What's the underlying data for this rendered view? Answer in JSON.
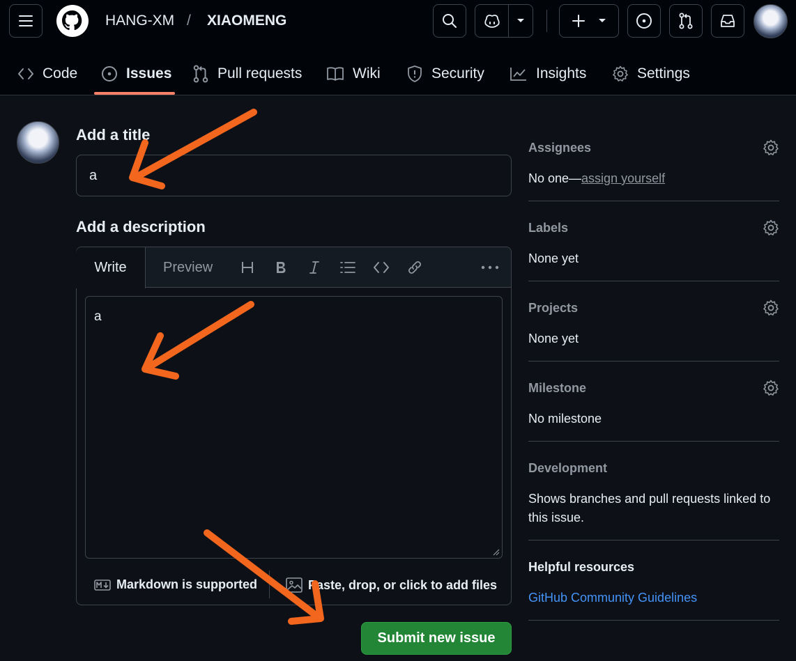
{
  "header": {
    "owner": "HANG-XM",
    "separator": "/",
    "repo": "XIAOMENG",
    "icons": [
      "hamburger-icon",
      "github-logo",
      "search-icon",
      "copilot-icon",
      "chevron-down-icon",
      "plus-icon",
      "issue-icon",
      "pull-request-icon",
      "inbox-icon"
    ]
  },
  "tabs": [
    {
      "label": "Code",
      "icon": "code-icon"
    },
    {
      "label": "Issues",
      "icon": "issue-opened-icon",
      "active": true
    },
    {
      "label": "Pull requests",
      "icon": "git-pull-request-icon"
    },
    {
      "label": "Wiki",
      "icon": "book-icon"
    },
    {
      "label": "Security",
      "icon": "shield-icon"
    },
    {
      "label": "Insights",
      "icon": "graph-icon"
    },
    {
      "label": "Settings",
      "icon": "gear-icon"
    }
  ],
  "form": {
    "title_heading": "Add a title",
    "title_value": "a",
    "description_heading": "Add a description",
    "editor_tabs": {
      "write": "Write",
      "preview": "Preview"
    },
    "toolbar_icons": [
      "heading-icon",
      "bold-icon",
      "italic-icon",
      "list-icon",
      "code-icon",
      "link-icon",
      "more-icon"
    ],
    "description_value": "a",
    "markdown_note": "Markdown is supported",
    "attach_note": "Paste, drop, or click to add files",
    "submit_label": "Submit new issue"
  },
  "sidebar": {
    "assignees": {
      "heading": "Assignees",
      "value_prefix": "No one—",
      "value_link": "assign yourself"
    },
    "labels": {
      "heading": "Labels",
      "value": "None yet"
    },
    "projects": {
      "heading": "Projects",
      "value": "None yet"
    },
    "milestone": {
      "heading": "Milestone",
      "value": "No milestone"
    },
    "development": {
      "heading": "Development",
      "value": "Shows branches and pull requests linked to this issue."
    },
    "helpful": {
      "heading": "Helpful resources",
      "link": "GitHub Community Guidelines"
    }
  },
  "colors": {
    "background": "#0d1117",
    "header": "#010409",
    "border": "#3d444d",
    "accent_underline": "#f78166",
    "submit": "#238636",
    "link": "#4493f8",
    "annotation_arrow": "#f2661d"
  }
}
